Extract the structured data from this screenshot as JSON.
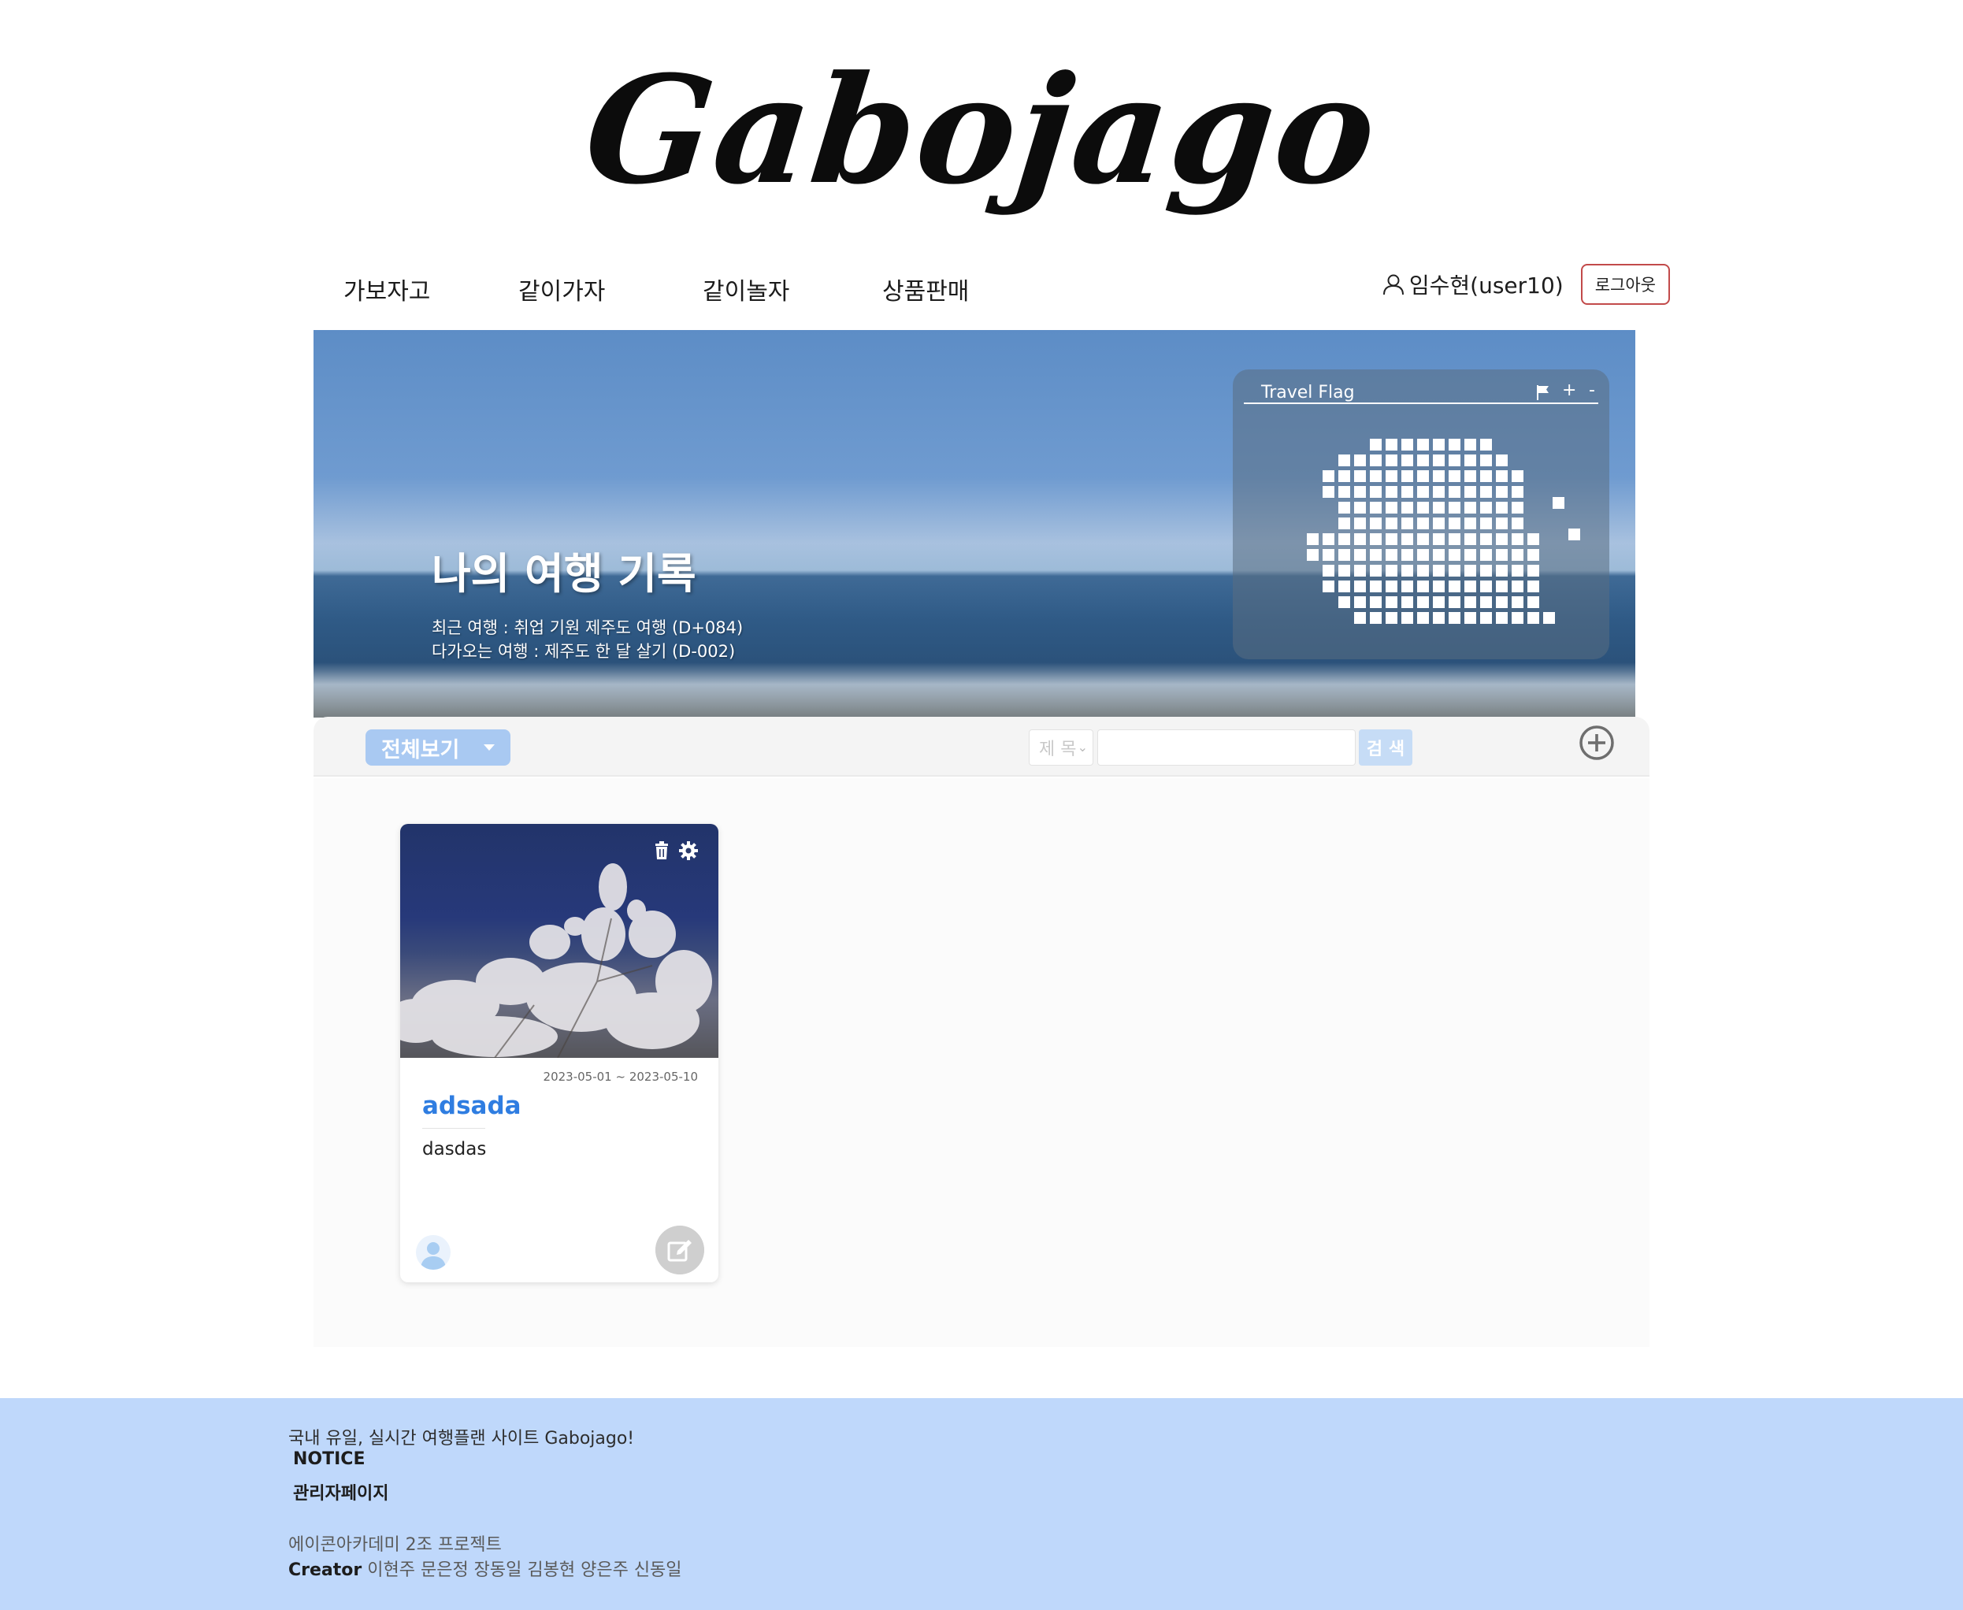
{
  "brand": {
    "logo_text": "Gabojago"
  },
  "nav": {
    "items": [
      {
        "label": "가보자고"
      },
      {
        "label": "같이가자"
      },
      {
        "label": "같이놀자"
      },
      {
        "label": "상품판매"
      }
    ],
    "user_name": "임수현(user10)",
    "logout_label": "로그아웃",
    "user_icon": "person-icon"
  },
  "hero": {
    "title": "나의 여행 기록",
    "recent_trip": "최근 여행 : 취업 기원 제주도 여행 (D+084)",
    "upcoming_trip": "다가오는 여행 : 제주도 한 달 살기 (D-002)"
  },
  "travel_flag": {
    "title": "Travel Flag",
    "flag_icon": "flag-icon",
    "zoom_in": "+",
    "zoom_out": "-"
  },
  "toolbar": {
    "filter_label": "전체보기",
    "search_select_value": "제 목",
    "search_input_value": "",
    "search_button": "검 색",
    "add_icon": "plus-circle-icon"
  },
  "cards": [
    {
      "date_range": "2023-05-01 ~ 2023-05-10",
      "title": "adsada",
      "description": "dasdas",
      "delete_icon": "trash-icon",
      "settings_icon": "gear-icon",
      "edit_icon": "edit-icon"
    }
  ],
  "footer": {
    "tagline": "국내 유일, 실시간 여행플랜 사이트 Gabojago!",
    "notice_label": "NOTICE",
    "admin_label": "관리자페이지",
    "project": "에이콘아카데미 2조 프로젝트",
    "creator_label": "Creator",
    "creators": "이현주 문은정 장동일 김봉현 양은주 신동일"
  },
  "colors": {
    "accent_blue": "#2f7de1",
    "filter_button": "#a9c9f2",
    "footer_bg": "#bfd8fb",
    "logout_border": "#c24a4a"
  }
}
